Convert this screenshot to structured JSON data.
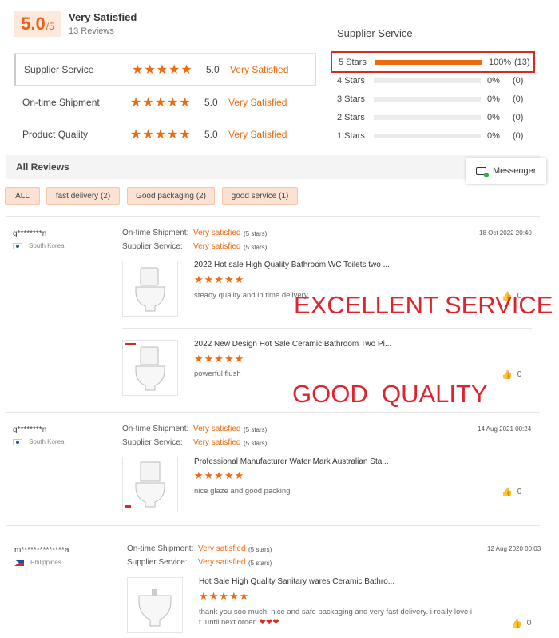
{
  "summary": {
    "score": "5.0",
    "score_max": "/5",
    "rating_label": "Very Satisfied",
    "reviews_count": "13 Reviews"
  },
  "categories": [
    {
      "label": "Supplier Service",
      "stars": "★★★★★",
      "score": "5.0",
      "status": "Very Satisfied"
    },
    {
      "label": "On-time Shipment",
      "stars": "★★★★★",
      "score": "5.0",
      "status": "Very Satisfied"
    },
    {
      "label": "Product Quality",
      "stars": "★★★★★",
      "score": "5.0",
      "status": "Very Satisfied"
    }
  ],
  "distribution": {
    "title": "Supplier Service",
    "rows": [
      {
        "label": "5 Stars",
        "percent": "100%",
        "count": "(13)",
        "fill": 1.0
      },
      {
        "label": "4 Stars",
        "percent": "0%",
        "count": "(0)",
        "fill": 0
      },
      {
        "label": "3 Stars",
        "percent": "0%",
        "count": "(0)",
        "fill": 0
      },
      {
        "label": "2 Stars",
        "percent": "0%",
        "count": "(0)",
        "fill": 0
      },
      {
        "label": "1 Stars",
        "percent": "0%",
        "count": "(0)",
        "fill": 0
      }
    ]
  },
  "all_reviews": {
    "title": "All Reviews"
  },
  "messenger": {
    "label": "Messenger"
  },
  "filters": [
    "ALL",
    "fast delivery (2)",
    "Good packaging (2)",
    "good service (1)"
  ],
  "reviews": [
    {
      "user": "g********n",
      "country": "South Korea",
      "shipment_label": "On-time Shipment:",
      "shipment_value": "Very satisfied",
      "shipment_stars": "(5 stars)",
      "service_label": "Supplier Service:",
      "service_value": "Very satisfied",
      "service_stars": "(5 stars)",
      "date": "18 Oct 2022 20:40",
      "products": [
        {
          "title": "2022 Hot sale High Quality Bathroom WC Toilets two ...",
          "stars": "★★★★★",
          "comment": "steady quality and in time delivery",
          "likes": "0"
        },
        {
          "title": "2022 New Design Hot Sale Ceramic Bathroom Two Pi...",
          "stars": "★★★★★",
          "comment": "powerful flush",
          "likes": "0"
        }
      ]
    },
    {
      "user": "g********n",
      "country": "South Korea",
      "shipment_label": "On-time Shipment:",
      "shipment_value": "Very satisfied",
      "shipment_stars": "(5 stars)",
      "service_label": "Supplier Service:",
      "service_value": "Very satisfied",
      "service_stars": "(5 stars)",
      "date": "14 Aug 2021 00:24",
      "products": [
        {
          "title": "Professional Manufacturer Water Mark Australian Sta...",
          "stars": "★★★★★",
          "comment": "nice glaze and good packing",
          "likes": "0"
        }
      ]
    },
    {
      "user": "m**************a",
      "country": "Philippines",
      "shipment_label": "On-time Shipment:",
      "shipment_value": "Very satisfied",
      "shipment_stars": "(5 stars)",
      "service_label": "Supplier Service:",
      "service_value": "Very satisfied",
      "service_stars": "(5 stars)",
      "date": "12 Aug 2020 00:03",
      "products": [
        {
          "title": "Hot Sale High Quality Sanitary wares Ceramic Bathro...",
          "stars": "★★★★★",
          "comment_line1": "thank you soo much. nice and safe packaging and very fast delivery. i really love i",
          "comment_line2": "t. until next order.",
          "hearts": "❤❤❤",
          "likes": "0"
        }
      ]
    }
  ],
  "overlays": {
    "excellent": "EXCELLENT SERVICE",
    "good": "GOOD  QUALITY"
  },
  "colors": {
    "accent": "#ed6a0e",
    "highlight_border": "#d62b1e",
    "overlay_text": "#e0232f"
  }
}
